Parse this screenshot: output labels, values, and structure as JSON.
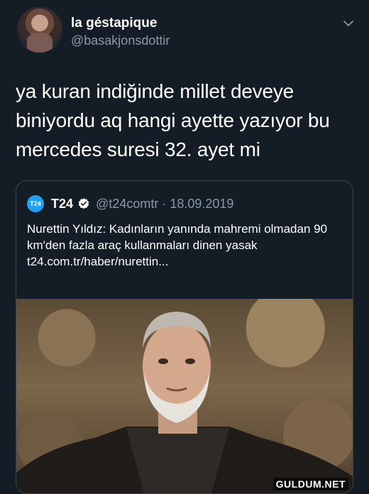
{
  "author": {
    "display_name": "la géstapique",
    "handle": "@basakjonsdottir"
  },
  "tweet": {
    "text": "ya kuran indiğinde millet deveye biniyordu aq hangi ayette yazıyor bu mercedes suresi 32. ayet mi"
  },
  "quoted": {
    "logo_text": "T24",
    "name": "T24",
    "handle_date": "@t24comtr · 18.09.2019",
    "text": "Nurettin Yıldız: Kadınların yanında mahremi olmadan 90 km'den fazla araç kullanmaları dinen yasak",
    "link": "t24.com.tr/haber/nurettin..."
  },
  "watermark": "GULDUM.NET",
  "colors": {
    "background": "#141d26",
    "secondary_text": "#8899a6",
    "border": "#38444d",
    "verified": "#ffffff",
    "logo": "#1ea1f2"
  }
}
